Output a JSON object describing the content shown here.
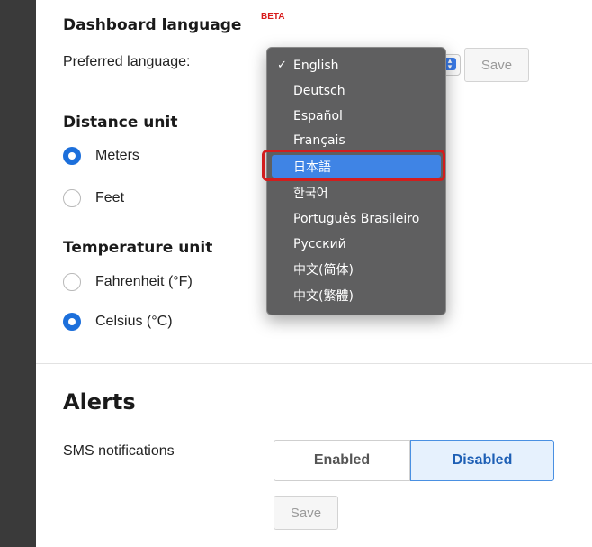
{
  "dashboard_language": {
    "title": "Dashboard language",
    "badge": "BETA",
    "preferred_label": "Preferred language:",
    "save_label": "Save",
    "options": [
      {
        "label": "English",
        "checked": true
      },
      {
        "label": "Deutsch"
      },
      {
        "label": "Español"
      },
      {
        "label": "Français"
      },
      {
        "label": "日本語",
        "highlighted": true
      },
      {
        "label": "한국어"
      },
      {
        "label": "Português Brasileiro"
      },
      {
        "label": "Русский"
      },
      {
        "label": "中文(简体)"
      },
      {
        "label": "中文(繁體)"
      }
    ],
    "checkmark": "✓"
  },
  "distance_unit": {
    "title": "Distance unit",
    "options": [
      {
        "label": "Meters",
        "selected": true
      },
      {
        "label": "Feet",
        "selected": false
      }
    ]
  },
  "temperature_unit": {
    "title": "Temperature unit",
    "options": [
      {
        "label": "Fahrenheit (°F)",
        "selected": false
      },
      {
        "label": "Celsius (°C)",
        "selected": true
      }
    ]
  },
  "alerts": {
    "title": "Alerts",
    "sms_label": "SMS notifications",
    "enabled_label": "Enabled",
    "disabled_label": "Disabled",
    "active": "Disabled",
    "save_label": "Save"
  },
  "colors": {
    "accent": "#1c6fdb",
    "menu_selection": "#3f84e5",
    "highlight_box": "#d21d1d",
    "beta": "#d81b1b"
  }
}
